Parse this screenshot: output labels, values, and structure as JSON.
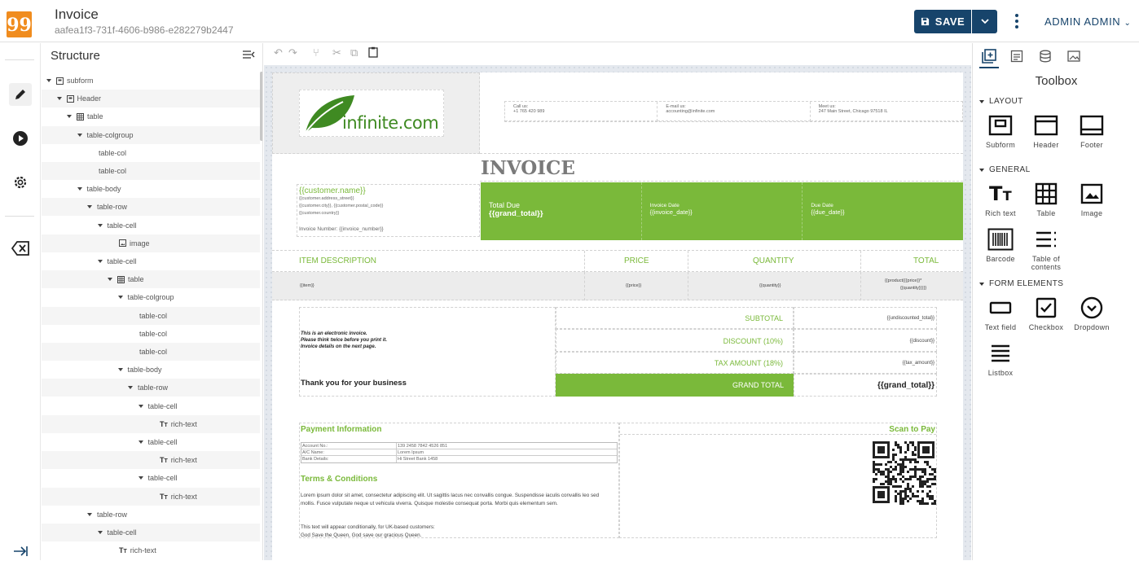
{
  "header": {
    "logo_glyph": "99",
    "title": "Invoice",
    "doc_id": "aafea1f3-731f-4606-b986-e282279b2447",
    "save_label": "SAVE",
    "user_label": "ADMIN ADMIN"
  },
  "sidebar": {
    "items": [
      "edit-icon",
      "play-icon",
      "settings-icon",
      "clear-icon",
      "expand-icon"
    ]
  },
  "structure": {
    "title": "Structure",
    "tree": [
      {
        "label": "subform",
        "depth": 0,
        "icon": "subform",
        "arrow": true
      },
      {
        "label": "Header",
        "depth": 1,
        "icon": "subform",
        "arrow": true
      },
      {
        "label": "table",
        "depth": 2,
        "icon": "table",
        "arrow": true
      },
      {
        "label": "table-colgroup",
        "depth": 3,
        "icon": "",
        "arrow": true
      },
      {
        "label": "table-col",
        "depth": 4,
        "icon": "",
        "arrow": false
      },
      {
        "label": "table-col",
        "depth": 4,
        "icon": "",
        "arrow": false
      },
      {
        "label": "table-body",
        "depth": 3,
        "icon": "",
        "arrow": true
      },
      {
        "label": "table-row",
        "depth": 4,
        "icon": "",
        "arrow": true
      },
      {
        "label": "table-cell",
        "depth": 5,
        "icon": "",
        "arrow": true
      },
      {
        "label": "image",
        "depth": 6,
        "icon": "image",
        "arrow": false
      },
      {
        "label": "table-cell",
        "depth": 5,
        "icon": "",
        "arrow": true
      },
      {
        "label": "table",
        "depth": 6,
        "icon": "table",
        "arrow": true
      },
      {
        "label": "table-colgroup",
        "depth": 7,
        "icon": "",
        "arrow": true
      },
      {
        "label": "table-col",
        "depth": 8,
        "icon": "",
        "arrow": false
      },
      {
        "label": "table-col",
        "depth": 8,
        "icon": "",
        "arrow": false
      },
      {
        "label": "table-col",
        "depth": 8,
        "icon": "",
        "arrow": false
      },
      {
        "label": "table-body",
        "depth": 7,
        "icon": "",
        "arrow": true
      },
      {
        "label": "table-row",
        "depth": 8,
        "icon": "",
        "arrow": true
      },
      {
        "label": "table-cell",
        "depth": 9,
        "icon": "",
        "arrow": true
      },
      {
        "label": "rich-text",
        "depth": 10,
        "icon": "text",
        "arrow": false
      },
      {
        "label": "table-cell",
        "depth": 9,
        "icon": "",
        "arrow": true
      },
      {
        "label": "rich-text",
        "depth": 10,
        "icon": "text",
        "arrow": false
      },
      {
        "label": "table-cell",
        "depth": 9,
        "icon": "",
        "arrow": true
      },
      {
        "label": "rich-text",
        "depth": 10,
        "icon": "text",
        "arrow": false
      },
      {
        "label": "table-row",
        "depth": 4,
        "icon": "",
        "arrow": true
      },
      {
        "label": "table-cell",
        "depth": 5,
        "icon": "",
        "arrow": true
      },
      {
        "label": "rich-text",
        "depth": 6,
        "icon": "text",
        "arrow": false
      }
    ]
  },
  "invoice": {
    "brand": "infinite.com",
    "call_label": "Call us:",
    "call_value": "+1 765 420 989",
    "email_label": "E-mail us:",
    "email_value": "accounting@infinite.com",
    "meet_label": "Meet us:",
    "meet_value": "247 Main Street, Chicago 97518 IL",
    "title": "INVOICE",
    "customer_name": "{{customer.name}}",
    "customer_street": "{{customer.address_street}}",
    "customer_city": "{{customer.city}}, {{customer.postal_code}}",
    "customer_country": "{{customer.country}}",
    "invoice_number": "Invoice Number: {{invoice_number}}",
    "total_due_label": "Total Due",
    "total_due_value": "{{grand_total}}",
    "invoice_date_label": "Invoice Date",
    "invoice_date_value": "{{invoice_date}}",
    "due_date_label": "Due Date",
    "due_date_value": "{{due_date}}",
    "col_item": "ITEM DESCRIPTION",
    "col_price": "PRICE",
    "col_qty": "QUANTITY",
    "col_total": "TOTAL",
    "row_item": "{{item}}",
    "row_price": "{{price}}",
    "row_qty": "{{quantity}}",
    "row_total_1": "{{product({{price}}*",
    "row_total_2": "{{quantity}})}}",
    "note_1": "This is an electronic invoice.",
    "note_2": "Please think twice before you print it.",
    "note_3": "Invoice details on the next page.",
    "thanks": "Thank you for your business",
    "subtotal_label": "SUBTOTAL",
    "subtotal_value": "{{undiscounted_total}}",
    "discount_label": "DISCOUNT (10%)",
    "discount_value": "{{discount}}",
    "tax_label": "TAX AMOUNT (18%)",
    "tax_value": "{{tax_amount}}",
    "grand_label": "GRAND TOTAL",
    "grand_value": "{{grand_total}}",
    "payment_title": "Payment Information",
    "scan_title": "Scan to Pay",
    "acct_label": "Account No.:",
    "acct_value": "139 2458 7842 4526 851",
    "ac_label": "A/C Name:",
    "ac_value": "Lorem Ipsum",
    "bank_label": "Bank Details:",
    "bank_value": "Hi Street Bank 1458",
    "terms_title": "Terms & Conditions",
    "terms_body": "Lorem ipsum dolor sit amet, consectetur adipiscing elit. Ut sagittis lacus nec convallis congue. Suspendisse iaculis convallis leo sed mollis. Fusce vulputate neque ut vehicula viverra. Quisque molestie consequat porta. Morbi quis elementum sem.",
    "cond_1": "This text will appear conditionally, for UK-based customers:",
    "cond_2": "God Save the Queen, God save our gracious Queen."
  },
  "toolbox": {
    "title": "Toolbox",
    "section_layout": "LAYOUT",
    "section_general": "GENERAL",
    "section_form": "FORM ELEMENTS",
    "subform": "Subform",
    "header": "Header",
    "footer": "Footer",
    "rich_text": "Rich text",
    "table": "Table",
    "image": "Image",
    "barcode": "Barcode",
    "toc_1": "Table of",
    "toc_2": "contents",
    "text_field": "Text field",
    "checkbox": "Checkbox",
    "dropdown": "Dropdown",
    "listbox": "Listbox"
  },
  "colors": {
    "brand_dark": "#17446b",
    "accent_green": "#7ab93a",
    "logo_orange": "#f08c1e"
  }
}
